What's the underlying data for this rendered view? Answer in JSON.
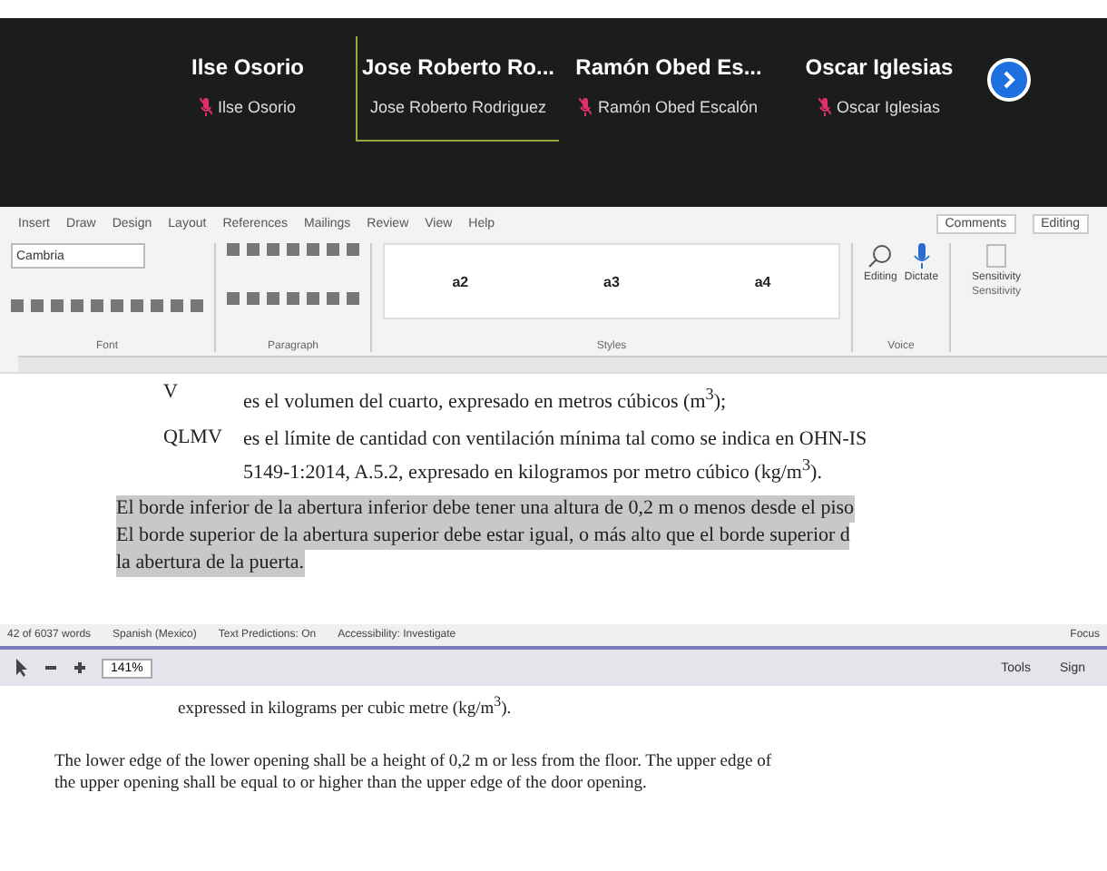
{
  "participants": [
    {
      "name": "Ilse Osorio",
      "label": "Ilse Osorio",
      "muted": true,
      "selected": false
    },
    {
      "name": "Jose Roberto Ro...",
      "label": "Jose Roberto Rodriguez",
      "muted": false,
      "selected": true
    },
    {
      "name": "Ramón Obed Es...",
      "label": "Ramón Obed Escalón",
      "muted": true,
      "selected": false
    },
    {
      "name": "Oscar Iglesias",
      "label": "Oscar Iglesias",
      "muted": true,
      "selected": false
    }
  ],
  "ribbon": {
    "tabs": [
      "Insert",
      "Draw",
      "Design",
      "Layout",
      "References",
      "Mailings",
      "Review",
      "View",
      "Help"
    ],
    "comments": "Comments",
    "editing_mode": "Editing",
    "font": "Cambria",
    "styles": [
      "a2",
      "a3",
      "a4"
    ],
    "big_buttons": [
      "Editing",
      "Dictate",
      "Sensitivity"
    ],
    "groups": [
      "Font",
      "Paragraph",
      "Styles",
      "Voice",
      "Sensitivity"
    ]
  },
  "document": {
    "definitions": [
      {
        "term": "V",
        "lines": [
          "es el volumen del cuarto, expresado en metros cúbicos (m$^{3}$);"
        ]
      },
      {
        "term": "QLMV",
        "lines": [
          "es el límite de cantidad con ventilación mínima tal como se indica en OHN-IS",
          "5149-1:2014, A.5.2, expresado en kilogramos por metro cúbico (kg/m$^{3}$)."
        ]
      }
    ],
    "highlighted_lines": [
      "El borde inferior de la abertura inferior debe tener una altura de 0,2 m o menos desde el piso",
      "El borde superior de la abertura superior debe estar igual, o más alto que el borde superior d",
      "la abertura de la puerta."
    ]
  },
  "status_bar": {
    "words": "42 of 6037 words",
    "language": "Spanish (Mexico)",
    "predictions": "Text Predictions: On",
    "accessibility": "Accessibility: Investigate",
    "focus": "Focus"
  },
  "pdf_toolbar": {
    "zoom": "141%",
    "tools": "Tools",
    "sign": "Sign"
  },
  "pdf_document": {
    "definition_tail": "expressed in kilograms per cubic metre (kg/m$^{3}$).",
    "paragraph_lines": [
      "The lower edge of the lower opening shall be a height of 0,2 m or less from the floor. The upper edge of",
      "the upper opening shall be equal to or higher than the upper edge of the door opening."
    ]
  }
}
